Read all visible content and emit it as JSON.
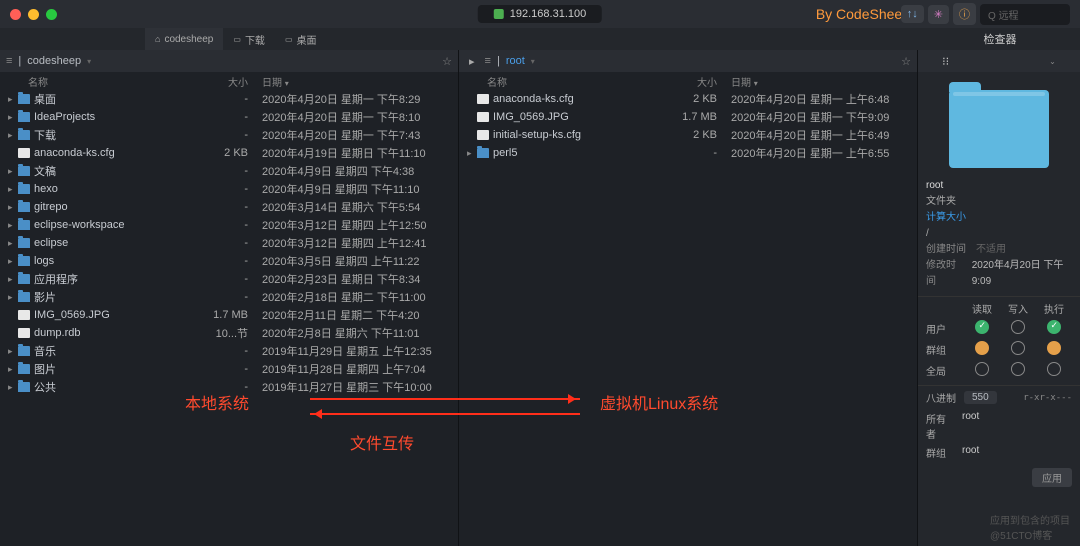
{
  "titlebar": {
    "host": "192.168.31.100",
    "brand": "By CodeSheep",
    "search_placeholder": "远程"
  },
  "tabs": {
    "left": [
      {
        "label": "codesheep",
        "cls": "home active"
      },
      {
        "label": "下载",
        "cls": "fold"
      },
      {
        "label": "桌面",
        "cls": "fold"
      }
    ],
    "inspector_title": "检查器"
  },
  "local": {
    "path": "codesheep",
    "cols": {
      "name": "名称",
      "size": "大小",
      "date": "日期"
    },
    "rows": [
      {
        "d": "▸",
        "t": "folder",
        "n": "桌面",
        "s": "-",
        "dt": "2020年4月20日 星期一 下午8:29"
      },
      {
        "d": "▸",
        "t": "folder",
        "n": "IdeaProjects",
        "s": "-",
        "dt": "2020年4月20日 星期一 下午8:10"
      },
      {
        "d": "▸",
        "t": "folder",
        "n": "下载",
        "s": "-",
        "dt": "2020年4月20日 星期一 下午7:43"
      },
      {
        "d": "",
        "t": "file",
        "n": "anaconda-ks.cfg",
        "s": "2 KB",
        "dt": "2020年4月19日 星期日 下午11:10"
      },
      {
        "d": "▸",
        "t": "folder",
        "n": "文稿",
        "s": "-",
        "dt": "2020年4月9日 星期四 下午4:38"
      },
      {
        "d": "▸",
        "t": "folder",
        "n": "hexo",
        "s": "-",
        "dt": "2020年4月9日 星期四 下午11:10"
      },
      {
        "d": "▸",
        "t": "folder",
        "n": "gitrepo",
        "s": "-",
        "dt": "2020年3月14日 星期六 下午5:54"
      },
      {
        "d": "▸",
        "t": "folder",
        "n": "eclipse-workspace",
        "s": "-",
        "dt": "2020年3月12日 星期四 上午12:50"
      },
      {
        "d": "▸",
        "t": "folder",
        "n": "eclipse",
        "s": "-",
        "dt": "2020年3月12日 星期四 上午12:41"
      },
      {
        "d": "▸",
        "t": "folder",
        "n": "logs",
        "s": "-",
        "dt": "2020年3月5日 星期四 上午11:22"
      },
      {
        "d": "▸",
        "t": "folder",
        "n": "应用程序",
        "s": "-",
        "dt": "2020年2月23日 星期日 下午8:34"
      },
      {
        "d": "▸",
        "t": "folder",
        "n": "影片",
        "s": "-",
        "dt": "2020年2月18日 星期二 下午11:00"
      },
      {
        "d": "",
        "t": "file",
        "n": "IMG_0569.JPG",
        "s": "1.7 MB",
        "dt": "2020年2月11日 星期二 下午4:20"
      },
      {
        "d": "",
        "t": "file",
        "n": "dump.rdb",
        "s": "10...节",
        "dt": "2020年2月8日 星期六 下午11:01"
      },
      {
        "d": "▸",
        "t": "folder",
        "n": "音乐",
        "s": "-",
        "dt": "2019年11月29日 星期五 上午12:35"
      },
      {
        "d": "▸",
        "t": "folder",
        "n": "图片",
        "s": "-",
        "dt": "2019年11月28日 星期四 上午7:04"
      },
      {
        "d": "▸",
        "t": "folder",
        "n": "公共",
        "s": "-",
        "dt": "2019年11月27日 星期三 下午10:00"
      }
    ]
  },
  "remote": {
    "path": "root",
    "cols": {
      "name": "名称",
      "size": "大小",
      "date": "日期"
    },
    "rows": [
      {
        "d": "",
        "t": "file",
        "n": "anaconda-ks.cfg",
        "s": "2 KB",
        "dt": "2020年4月20日 星期一 上午6:48"
      },
      {
        "d": "",
        "t": "file",
        "n": "IMG_0569.JPG",
        "s": "1.7 MB",
        "dt": "2020年4月20日 星期一 下午9:09"
      },
      {
        "d": "",
        "t": "file",
        "n": "initial-setup-ks.cfg",
        "s": "2 KB",
        "dt": "2020年4月20日 星期一 上午6:49"
      },
      {
        "d": "▸",
        "t": "folder",
        "n": "perl5",
        "s": "-",
        "dt": "2020年4月20日 星期一 上午6:55"
      }
    ]
  },
  "inspector": {
    "name": "root",
    "kind": "文件夹",
    "calc": "计算大小",
    "path": "/",
    "ctime_k": "创建时间",
    "ctime_v": "不适用",
    "mtime_k": "修改时间",
    "mtime_v": "2020年4月20日 下午9:09",
    "perm": {
      "hdr": [
        "读取",
        "写入",
        "执行"
      ],
      "rows": [
        {
          "l": "用户",
          "v": [
            "g",
            "off",
            "g"
          ]
        },
        {
          "l": "群组",
          "v": [
            "o",
            "off",
            "o"
          ]
        },
        {
          "l": "全局",
          "v": [
            "off",
            "off",
            "off"
          ]
        }
      ]
    },
    "octal_k": "八进制",
    "octal_v": "550",
    "octal_sym": "r-xr-x---",
    "owner_k": "所有者",
    "owner_v": "root",
    "group_k": "群组",
    "group_v": "root",
    "apply": "应用"
  },
  "annot": {
    "left": "本地系统",
    "right": "虚拟机Linux系统",
    "mid": "文件互传"
  },
  "watermark": "应用到包含的项目\n@51CTO博客"
}
